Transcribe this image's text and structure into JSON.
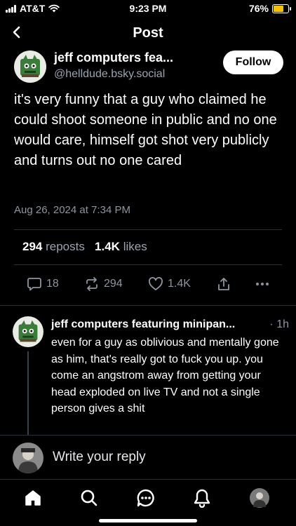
{
  "status_bar": {
    "carrier": "AT&T",
    "time": "9:23 PM",
    "battery_percent": "76%",
    "battery_level": 0.76,
    "battery_color": "#f5c400"
  },
  "nav": {
    "title": "Post",
    "back_icon": "chevron-left-icon"
  },
  "post": {
    "author_name": "jeff computers fea...",
    "author_handle": "@helldude.bsky.social",
    "follow_label": "Follow",
    "text": "it's very funny that a guy who claimed he could shoot someone in public and no one would care, himself got shot very publicly and turns out no one cared",
    "date": "Aug 26, 2024 at 7:34 PM",
    "reposts_count": "294",
    "reposts_label": "reposts",
    "likes_count": "1.4K",
    "likes_label": "likes",
    "actions": {
      "reply_count": "18",
      "repost_count": "294",
      "like_count": "1.4K"
    }
  },
  "reply": {
    "author_name": "jeff computers featuring minipan...",
    "time": "· 1h",
    "text": "even for a guy as oblivious and mentally gone as him, that's really got to fuck you up. you come an angstrom away from getting your head exploded on live TV and not a single person gives a shit"
  },
  "composer": {
    "placeholder": "Write your reply"
  },
  "tabbar": {
    "items": [
      "home-icon",
      "search-icon",
      "chat-icon",
      "bell-icon",
      "profile-avatar"
    ]
  },
  "colors": {
    "background": "#000000",
    "secondary_text": "#9aa4b0",
    "divider": "#2b3138"
  }
}
